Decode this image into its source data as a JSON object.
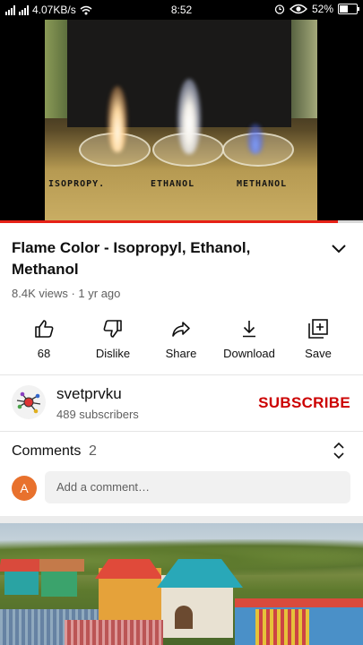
{
  "status_bar": {
    "network": "4.07KB/s",
    "time": "8:52",
    "battery": "52%",
    "battery_level": 0.52
  },
  "video": {
    "labels": [
      "ISOPROPY.",
      "ETHANOL",
      "METHANOL"
    ],
    "progress": 0.93
  },
  "details": {
    "title": "Flame Color - Isopropyl, Ethanol, Methanol",
    "meta": "8.4K views · 1 yr ago"
  },
  "actions": [
    {
      "icon": "thumbs-up-icon",
      "label": "68"
    },
    {
      "icon": "thumbs-down-icon",
      "label": "Dislike"
    },
    {
      "icon": "share-icon",
      "label": "Share"
    },
    {
      "icon": "download-icon",
      "label": "Download"
    },
    {
      "icon": "save-playlist-icon",
      "label": "Save"
    }
  ],
  "channel": {
    "name": "svetprvku",
    "subscribers": "489 subscribers",
    "subscribe_label": "SUBSCRIBE"
  },
  "comments": {
    "title": "Comments",
    "count": "2",
    "user_initial": "A",
    "placeholder": "Add a comment…"
  },
  "colors": {
    "accent": "#cc0000",
    "progress": "#e62117",
    "comment_avatar": "#e8712d"
  }
}
